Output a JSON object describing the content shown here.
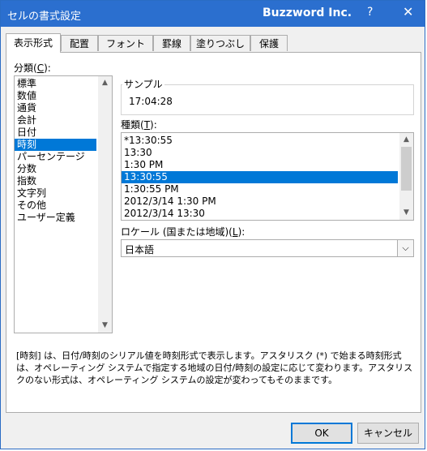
{
  "window": {
    "title": "セルの書式設定",
    "brand": "Buzzword Inc.",
    "help": "?",
    "close": "✕"
  },
  "tabs": [
    "表示形式",
    "配置",
    "フォント",
    "罫線",
    "塗りつぶし",
    "保護"
  ],
  "category": {
    "label_prefix": "分類(",
    "label_key": "C",
    "label_suffix": "):",
    "items": [
      "標準",
      "数値",
      "通貨",
      "会計",
      "日付",
      "時刻",
      "パーセンテージ",
      "分数",
      "指数",
      "文字列",
      "その他",
      "ユーザー定義"
    ],
    "selected_index": 5
  },
  "sample": {
    "label": "サンプル",
    "value": "17:04:28"
  },
  "type": {
    "label_prefix": "種類(",
    "label_key": "T",
    "label_suffix": "):",
    "items": [
      "*13:30:55",
      "13:30",
      "1:30 PM",
      "13:30:55",
      "1:30:55 PM",
      "2012/3/14 1:30 PM",
      "2012/3/14 13:30"
    ],
    "selected_index": 3
  },
  "locale": {
    "label_prefix": "ロケール (国または地域)(",
    "label_key": "L",
    "label_suffix": "):",
    "value": "日本語"
  },
  "description": "[時刻] は、日付/時刻のシリアル値を時刻形式で表示します。アスタリスク (*) で始まる時刻形式は、オペレーティング システムで指定する地域の日付/時刻の設定に応じて変わります。アスタリスクのない形式は、オペレーティング システムの設定が変わってもそのままです。",
  "buttons": {
    "ok": "OK",
    "cancel": "キャンセル"
  },
  "colors": {
    "titlebar": "#2b6fcf",
    "selection": "#0078d7"
  }
}
